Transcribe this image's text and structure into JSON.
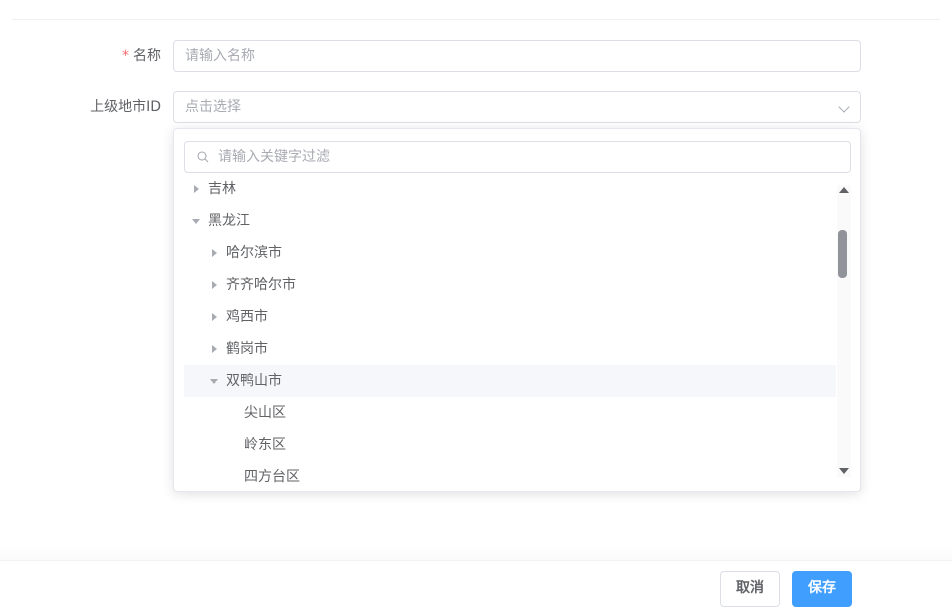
{
  "form": {
    "name_label": "名称",
    "name_required_mark": "*",
    "name_placeholder": "请输入名称",
    "parent_label": "上级地市ID",
    "parent_placeholder": "点击选择"
  },
  "dropdown": {
    "filter_placeholder": "请输入关键字过滤",
    "tree": [
      {
        "label": "吉林",
        "level": 0,
        "state": "collapsed"
      },
      {
        "label": "黑龙江",
        "level": 0,
        "state": "expanded"
      },
      {
        "label": "哈尔滨市",
        "level": 1,
        "state": "collapsed"
      },
      {
        "label": "齐齐哈尔市",
        "level": 1,
        "state": "collapsed"
      },
      {
        "label": "鸡西市",
        "level": 1,
        "state": "collapsed"
      },
      {
        "label": "鹤岗市",
        "level": 1,
        "state": "collapsed"
      },
      {
        "label": "双鸭山市",
        "level": 1,
        "state": "expanded",
        "highlighted": true
      },
      {
        "label": "尖山区",
        "level": 2,
        "state": "leaf"
      },
      {
        "label": "岭东区",
        "level": 2,
        "state": "leaf"
      },
      {
        "label": "四方台区",
        "level": 2,
        "state": "leaf"
      }
    ]
  },
  "footer": {
    "cancel_label": "取消",
    "save_label": "保存"
  },
  "colors": {
    "primary": "#409eff",
    "required": "#f56c6c",
    "highlight_row": "#f5f7fa"
  }
}
